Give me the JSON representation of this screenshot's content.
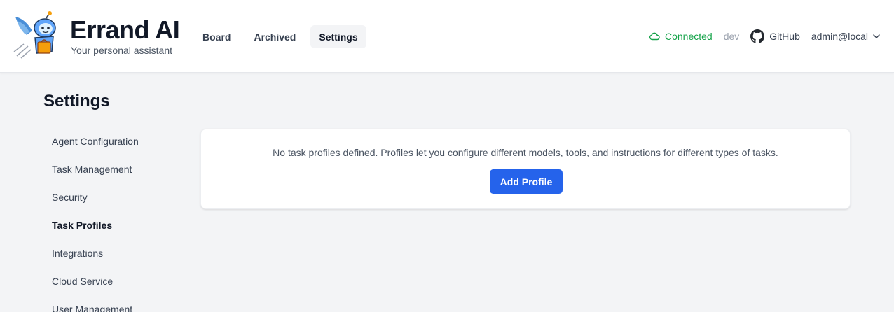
{
  "header": {
    "title": "Errand AI",
    "subtitle": "Your personal assistant",
    "logo_icon": "robot-mascot-icon",
    "nav": [
      {
        "label": "Board",
        "active": false
      },
      {
        "label": "Archived",
        "active": false
      },
      {
        "label": "Settings",
        "active": true
      }
    ],
    "status": {
      "label": "Connected",
      "icon": "cloud-icon",
      "color": "#16a34a"
    },
    "environment": "dev",
    "github": {
      "label": "GitHub",
      "icon": "github-icon"
    },
    "user": {
      "label": "admin@local",
      "icon": "chevron-down-icon"
    }
  },
  "page": {
    "title": "Settings",
    "sidebar": [
      {
        "label": "Agent Configuration",
        "active": false
      },
      {
        "label": "Task Management",
        "active": false
      },
      {
        "label": "Security",
        "active": false
      },
      {
        "label": "Task Profiles",
        "active": true
      },
      {
        "label": "Integrations",
        "active": false
      },
      {
        "label": "Cloud Service",
        "active": false
      },
      {
        "label": "User Management",
        "active": false
      }
    ],
    "empty_state": {
      "message": "No task profiles defined. Profiles let you configure different models, tools, and instructions for different types of tasks.",
      "button_label": "Add Profile"
    }
  },
  "colors": {
    "accent": "#2563eb",
    "connected": "#16a34a",
    "background": "#f3f4f6"
  }
}
